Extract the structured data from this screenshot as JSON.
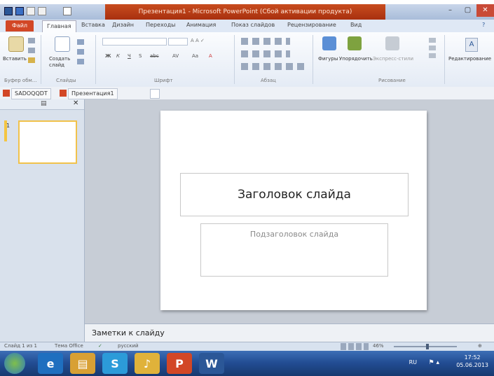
{
  "window": {
    "title": "Презентация1 - Microsoft PowerPoint (Сбой активации продукта)"
  },
  "ribbon_tabs": [
    "Файл",
    "Главная",
    "Вставка",
    "Дизайн",
    "Переходы",
    "Анимация",
    "Показ слайдов",
    "Рецензирование",
    "Вид"
  ],
  "ribbon": {
    "paste_label": "Вставить",
    "new_slide_label": "Создать слайд",
    "groups": [
      "Буфер обм...",
      "Слайды",
      "Шрифт",
      "Абзац",
      "Рисование",
      "Редактирование"
    ],
    "arrange_label": "Упорядочить",
    "shapes_label": "Фигуры",
    "quick_styles_label": "Экспресс-стили",
    "editing_label": "Редактирование"
  },
  "doc_tabs": [
    "SADOQQDT",
    "Презентация1"
  ],
  "thumbnail": {
    "number": "1"
  },
  "slide": {
    "title_placeholder": "Заголовок слайда",
    "subtitle_placeholder": "Подзаголовок слайда"
  },
  "notes": {
    "placeholder": "Заметки к слайду"
  },
  "status": {
    "slide_counter": "Слайд 1 из 1",
    "theme": "Тема Office",
    "language": "русский",
    "zoom": "46%"
  },
  "taskbar": {
    "lang": "RU",
    "time": "17:52",
    "date": "05.06.2013"
  },
  "colors": {
    "accent_file_tab": "#d24726",
    "title_active": "#b8391a",
    "thumb_border": "#f1c24b",
    "taskbar": "#234e95"
  }
}
